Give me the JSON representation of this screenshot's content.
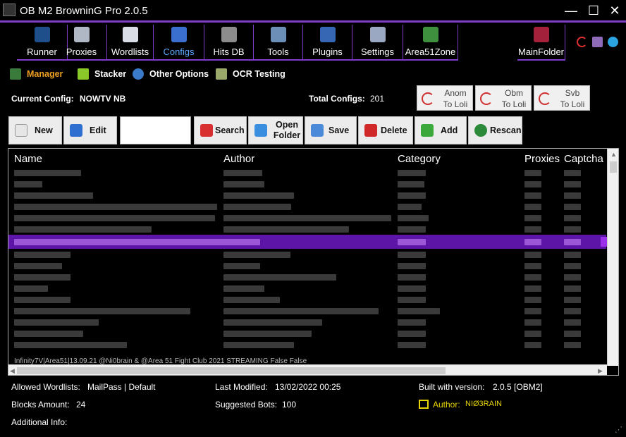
{
  "window": {
    "title": "OB M2 BrowninG Pro 2.0.5",
    "minimize": "—",
    "maximize": "☐",
    "close": "✕",
    "accent": "#7d3cc9"
  },
  "nav": {
    "tabs": [
      {
        "label": "Runner",
        "icon": "runner-icon"
      },
      {
        "label": "Proxies",
        "icon": "proxies-icon"
      },
      {
        "label": "Wordlists",
        "icon": "wordlists-icon"
      },
      {
        "label": "Configs",
        "icon": "configs-icon",
        "active": true
      },
      {
        "label": "Hits DB",
        "icon": "database-icon"
      },
      {
        "label": "Tools",
        "icon": "tools-icon"
      },
      {
        "label": "Plugins",
        "icon": "plugins-icon"
      },
      {
        "label": "Settings",
        "icon": "settings-icon"
      },
      {
        "label": "Area51Zone",
        "icon": "area51-icon"
      }
    ],
    "main_folder": "MainFolder"
  },
  "subtabs": [
    {
      "label": "Manager",
      "icon": "manager-icon",
      "active": true
    },
    {
      "label": "Stacker",
      "icon": "stacker-icon"
    },
    {
      "label": "Other Options",
      "icon": "globe-icon"
    },
    {
      "label": "OCR Testing",
      "icon": "ocr-icon"
    }
  ],
  "config": {
    "current_label": "Current Config:",
    "current_value": "NOWTV NB",
    "total_label": "Total Configs:",
    "total_value": "201"
  },
  "loli_buttons": [
    {
      "line1": "Anom",
      "line2": "To Loli"
    },
    {
      "line1": "Obm",
      "line2": "To Loli"
    },
    {
      "line1": "Svb",
      "line2": "To Loli"
    }
  ],
  "toolbar": {
    "new": "New",
    "edit": "Edit",
    "search_value": "",
    "search": "Search",
    "open_folder_1": "Open",
    "open_folder_2": "Folder",
    "save": "Save",
    "delete": "Delete",
    "add": "Add",
    "rescan": "Rescan"
  },
  "grid": {
    "columns": [
      "Name",
      "Author",
      "Category",
      "Proxies",
      "Captcha"
    ],
    "last_row_text": "Infinity7V|Area51|13.09.21                                                                    @Ni0brain & @Area 51 Fight Club 2021                           STREAMING                                   False          False"
  },
  "details": {
    "allowed_wordlists_label": "Allowed Wordlists:",
    "allowed_wordlists_value": "MailPass | Default",
    "blocks_label": "Blocks Amount:",
    "blocks_value": "24",
    "additional_label": "Additional Info:",
    "last_modified_label": "Last Modified:",
    "last_modified_value": "13/02/2022 00:25",
    "suggested_bots_label": "Suggested Bots:",
    "suggested_bots_value": "100",
    "built_label": "Built with version:",
    "built_value": "2.0.5 [OBM2]",
    "author_label": "Author:",
    "author_value": "NIØ3RAIN"
  }
}
